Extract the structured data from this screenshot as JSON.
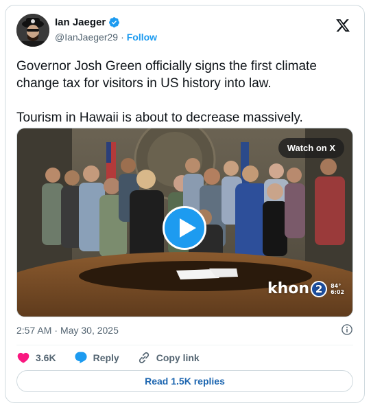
{
  "author": {
    "name": "Ian Jaeger",
    "handle": "@IanJaeger29",
    "separator": "·",
    "follow_label": "Follow"
  },
  "tweet": {
    "text": "Governor Josh Green officially signs the first climate change tax for visitors in US history into law.\n\nTourism in Hawaii is about to decrease massively."
  },
  "media": {
    "watch_label": "Watch on X",
    "station_logo": "khon",
    "station_number": "2",
    "temp": "84°",
    "time": "6:02"
  },
  "meta": {
    "time": "2:57 AM",
    "separator": "·",
    "date": "May 30, 2025"
  },
  "actions": {
    "likes": "3.6K",
    "reply_label": "Reply",
    "copy_label": "Copy link"
  },
  "read_replies_label": "Read 1.5K replies",
  "colors": {
    "accent": "#1d9bf0",
    "like": "#f91880",
    "text": "#0f1419",
    "muted": "#536471",
    "border": "#cfd9de"
  },
  "icons": [
    "verified-badge-icon",
    "x-logo-icon",
    "play-icon",
    "info-icon",
    "heart-icon",
    "reply-icon",
    "link-icon"
  ]
}
